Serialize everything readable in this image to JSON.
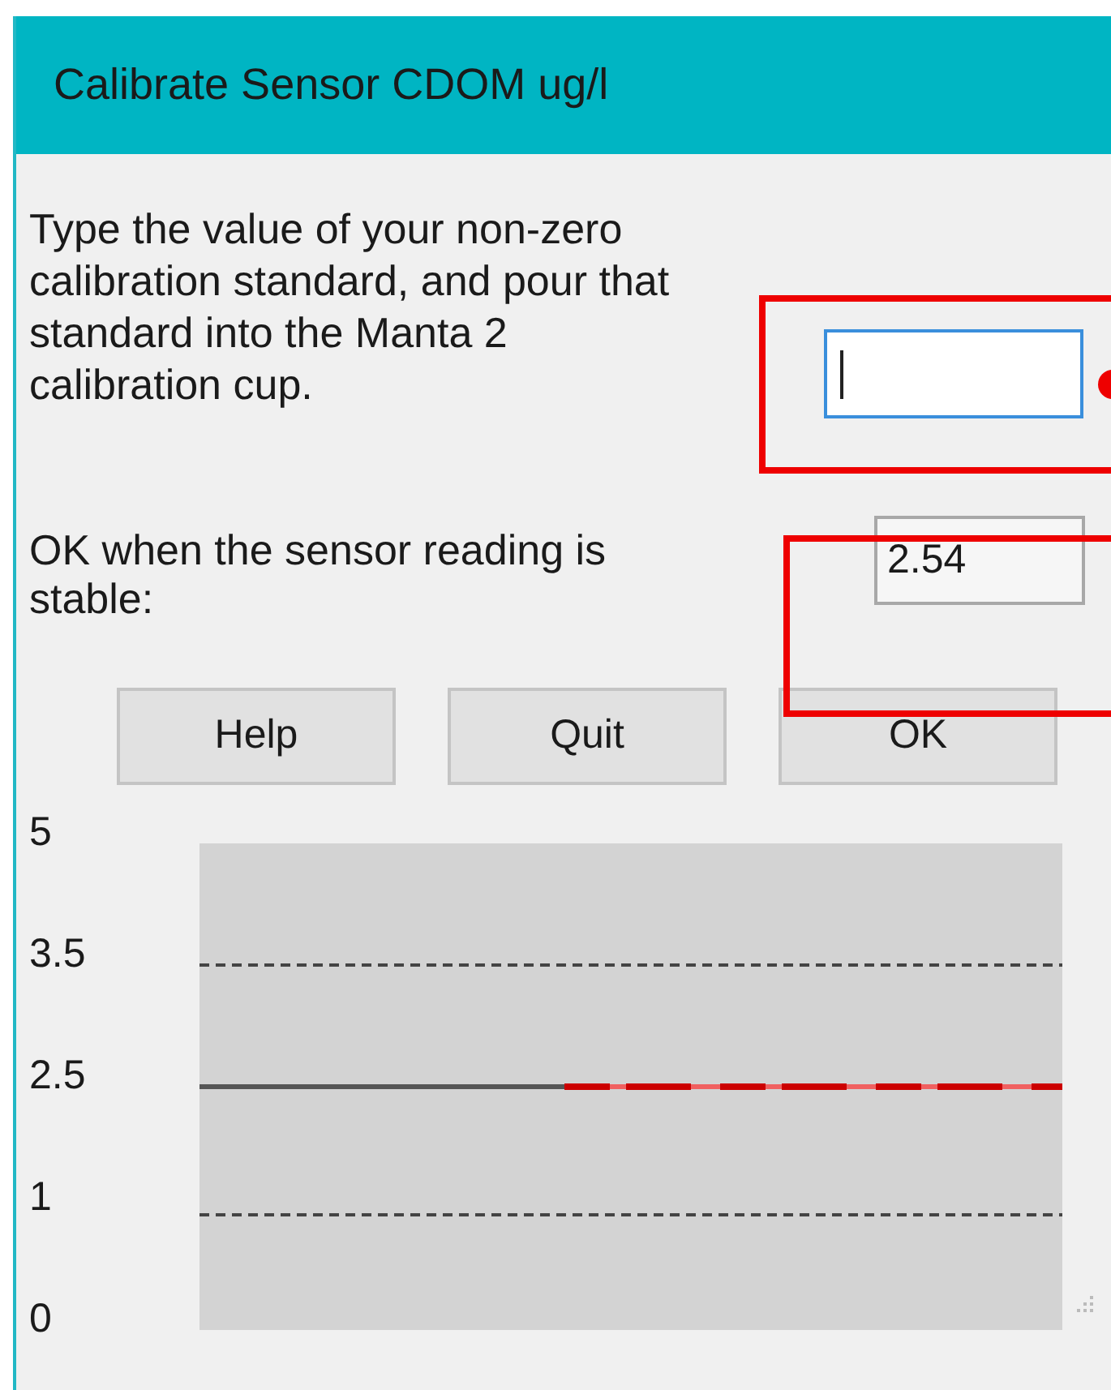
{
  "window": {
    "title": "Calibrate Sensor CDOM ug/l"
  },
  "standard": {
    "instruction": "Type the value of your non-zero calibration standard, and pour that standard into the Manta 2 calibration cup.",
    "focused": true
  },
  "reading": {
    "label": "OK when the sensor reading is stable:",
    "value": "2.54"
  },
  "buttons": [
    "Help",
    "Quit",
    "OK"
  ],
  "chart": {
    "y_labels": [
      "5",
      "3.5",
      "2.5",
      "1",
      "0"
    ]
  }
}
